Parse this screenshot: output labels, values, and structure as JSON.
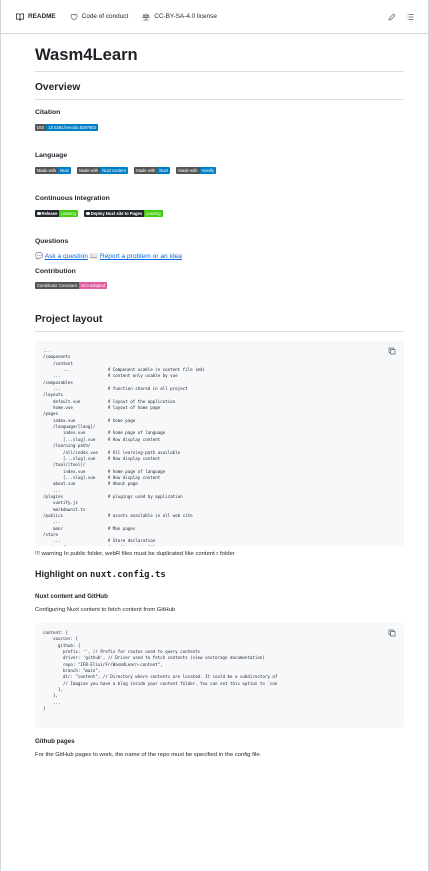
{
  "tabs": {
    "readme": "README",
    "conduct": "Code of conduct",
    "license": "CC-BY-SA-4.0 license"
  },
  "icons": {
    "book": "book-icon",
    "heart": "code-of-conduct-icon",
    "scale": "law-icon",
    "edit": "pencil-icon",
    "toc": "list-icon",
    "copy": "copy-icon"
  },
  "title": "Wasm4Learn",
  "overview": {
    "heading": "Overview",
    "citation": {
      "heading": "Citation",
      "badge": {
        "left": "DOI",
        "right": "10.5281/zenodo.8297663"
      }
    },
    "language": {
      "heading": "Language",
      "badges": [
        {
          "left": "Made with",
          "right": "Nuxt"
        },
        {
          "left": "Made with",
          "right": "Nuxt content"
        },
        {
          "left": "Made with",
          "right": "Nuxt"
        },
        {
          "left": "Made with",
          "right": "Vuetify"
        }
      ]
    },
    "ci": {
      "heading": "Continuous Integration",
      "badges": [
        {
          "left": "Release",
          "right": "passing"
        },
        {
          "left": "Deploy Nuxt site to Pages",
          "right": "passing"
        }
      ]
    },
    "questions": {
      "heading": "Questions",
      "link1": "Ask a question",
      "link2": "Report a problem or an idea",
      "emoji1": "💬",
      "emoji2": "📖"
    },
    "contribution": {
      "heading": "Contribution",
      "badge": {
        "left": "Contributor Covenant",
        "right": "v2.0 adopted"
      }
    }
  },
  "layout": {
    "heading": "Project layout",
    "code": "...\n/components\n    /content\n        ...               # Component usable in content file (md)\n    ...                   # content only usable by vue\n/composables\n    ...                   # function shared in all project\n/layouts\n    default.vue           # layout of the application\n    home.vue              # layout of home page\n/pages\n    index.vue             # home page\n    /language/[lang]/\n        index.vue         # home page of language\n        [...slug].vue     # How display content\n    /learning-path/\n        /all/index.vue    # All learning-path available\n        [...slug].vue     # How display content\n    /tool/[tool]/\n        index.vue         # home page of language\n        [...slug].vue     # How display content\n    about.vue             # About page\n    ...\n/plugins                  # plugings used by application\n    vuetify.js\n    markdownit.ts\n/publics                  # assets available in all web site\n    ...\n    man/                  # Man pages\n/store\n    ...                   # Store declaration\nnuxt.config.ts            # configuration file",
    "warning": "!!! warning In public folder, webR files must be duplicated like content r folder"
  },
  "highlight": {
    "heading_prefix": "Highlight on ",
    "heading_code": "nuxt.config.ts",
    "nuxt_heading": "Nuxt content and GitHub",
    "nuxt_text": "Configuring Nuxt content to fetch content from GitHub",
    "code": "content: {\n    sources: {\n      github: {\n        prefix: '', // Prefix for routes used to query contents\n        driver: 'github', // Driver used to fetch contents (view unstorage documentation)\n        repo: \"IFB-ElixirFr/Wasm4Learn-content\",\n        branch: \"main\",\n        dir: \"content\", // Directory where contents are located. It could be a subdirectory of\n        // Imagine you have a blog inside your content folder. You can set this option to `con\n      },\n    },\n    ...\n}",
    "pages_heading": "Github pages",
    "pages_text": "For the GitHub pages to work, the name of the repo must be specified in the config file."
  }
}
